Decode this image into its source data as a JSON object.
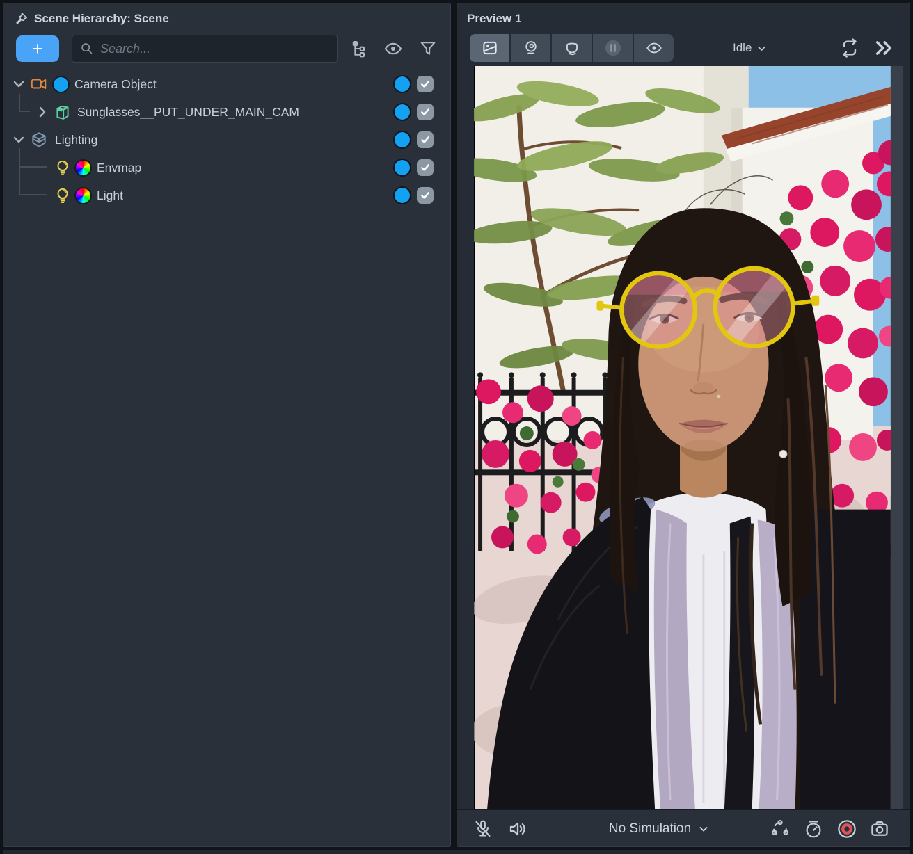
{
  "scene_panel": {
    "title": "Scene Hierarchy: Scene",
    "toolbar": {
      "add_label": "+",
      "search_placeholder": "Search..."
    },
    "tree": [
      {
        "label": "Camera Object"
      },
      {
        "label": "Sunglasses__PUT_UNDER_MAIN_CAM"
      },
      {
        "label": "Lighting"
      },
      {
        "label": "Envmap"
      },
      {
        "label": "Light"
      }
    ]
  },
  "preview_panel": {
    "title": "Preview 1",
    "state_label": "Idle",
    "simulation_label": "No Simulation"
  },
  "icons": {
    "left_toolbar": [
      "pin-icon",
      "search-icon",
      "tree-view-icon",
      "eye-icon",
      "filter-funnel-icon"
    ],
    "tree_icons": [
      "camera-icon",
      "mesh-box-icon",
      "cube-icon",
      "light-bulb-icon",
      "color-wheel-icon"
    ],
    "preview_toolbar": [
      "image-source-icon",
      "webcam-icon",
      "head-rotation-icon",
      "pause-icon",
      "eye-icon",
      "refresh-icon",
      "double-chevron-icon"
    ],
    "preview_bottom": [
      "microphone-muted-icon",
      "speaker-icon",
      "orbit-dots-icon",
      "stopwatch-icon",
      "record-icon",
      "snapshot-camera-icon"
    ]
  },
  "colors": {
    "accent_blue": "#14a1f1",
    "add_button_blue": "#49a3f6",
    "checkbox_gray": "#8d98a5",
    "camera_icon_orange": "#e0893c",
    "mesh_icon_teal": "#5ecfa0",
    "cube_icon_blue_gray": "#8096ad",
    "bulb_icon_yellow": "#e8d44d",
    "record_red": "#e0535a",
    "glasses_yellow": "#e3c70e",
    "panel_bg": "#2a303a"
  }
}
